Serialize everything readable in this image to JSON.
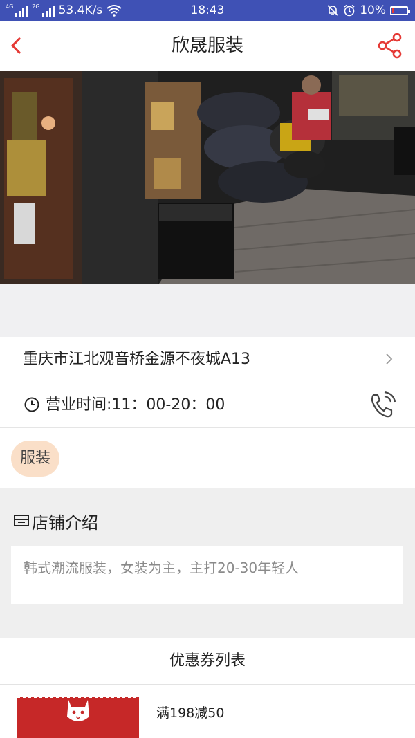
{
  "status_bar": {
    "network_speed": "53.4K/s",
    "time": "18:43",
    "battery": "10%",
    "signal_1_label": "4G",
    "signal_2_label": "2G"
  },
  "header": {
    "title": "欣晟服装",
    "back_icon": "chevron-left-icon",
    "share_icon": "share-icon",
    "accent_color": "#e53935"
  },
  "shop": {
    "address": "重庆市江北观音桥金源不夜城A13",
    "hours": "营业时间:11：00-20：00",
    "category_tag": "服装"
  },
  "intro": {
    "heading": "店铺介绍",
    "description": "韩式潮流服装，女装为主，主打20-30年轻人"
  },
  "coupons": {
    "heading": "优惠券列表",
    "items": [
      {
        "label": "满198减50"
      }
    ]
  }
}
